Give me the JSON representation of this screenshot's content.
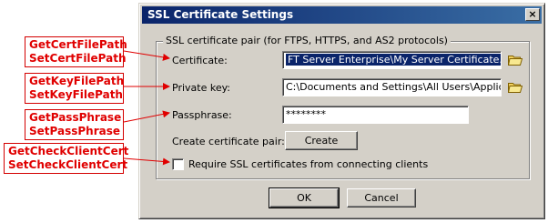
{
  "annotations": [
    {
      "line1": "GetCertFilePath",
      "line2": "SetCertFilePath"
    },
    {
      "line1": "GetKeyFilePath",
      "line2": "SetKeyFilePath"
    },
    {
      "line1": "GetPassPhrase",
      "line2": "SetPassPhrase"
    },
    {
      "line1": "GetCheckClientCert",
      "line2": "SetCheckClientCert"
    }
  ],
  "dialog": {
    "title": "SSL Certificate Settings",
    "close_glyph": "×",
    "group_label": "SSL certificate pair (for FTPS, HTTPS, and AS2 protocols)",
    "certificate": {
      "label": "Certificate:",
      "value": "FT Server Enterprise\\My Server Certificate.crt"
    },
    "private_key": {
      "label": "Private key:",
      "value": "C:\\Documents and Settings\\All Users\\Application"
    },
    "passphrase": {
      "label": "Passphrase:",
      "value": "********"
    },
    "create_pair": {
      "label": "Create certificate pair:",
      "button": "Create"
    },
    "require_ssl": {
      "label": "Require SSL certificates from connecting clients",
      "checked": false
    },
    "ok_label": "OK",
    "cancel_label": "Cancel"
  },
  "icons": {
    "browse": "folder-icon"
  },
  "colors": {
    "annotation": "#e00000",
    "titlebar_start": "#0a246a",
    "titlebar_end": "#3a6ea5",
    "window": "#d4d0c8"
  }
}
